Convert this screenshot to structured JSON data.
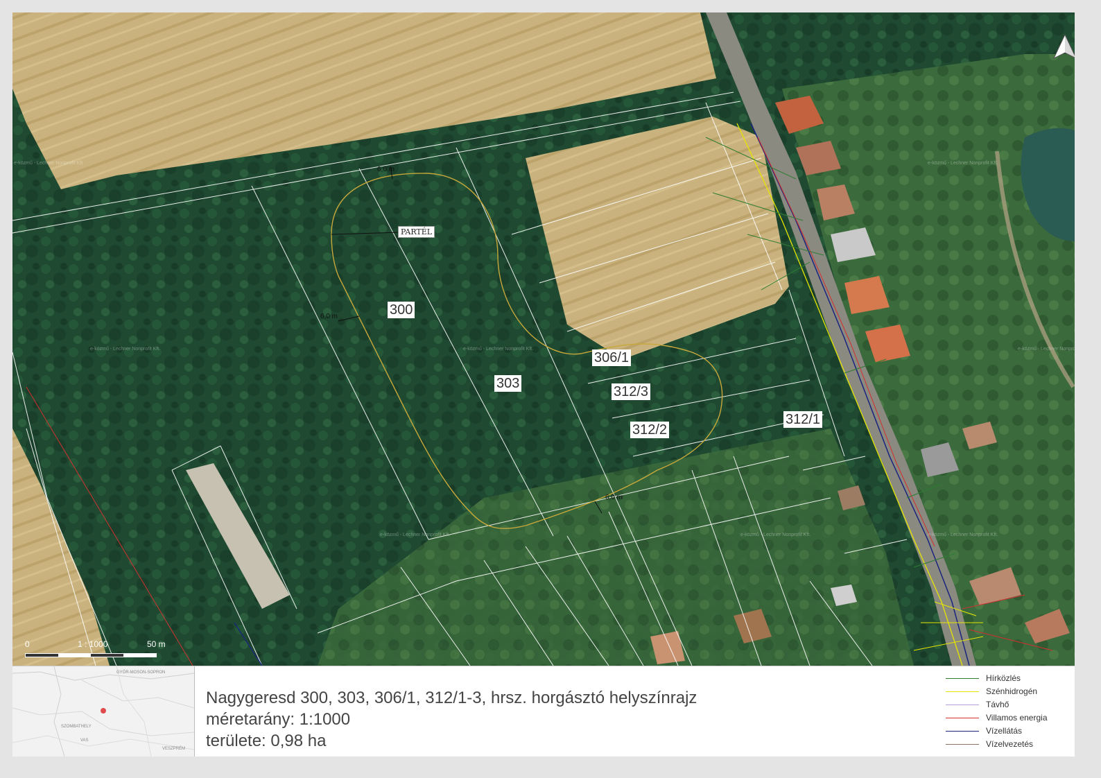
{
  "map": {
    "parcels": [
      {
        "id": "p300",
        "label": "300"
      },
      {
        "id": "p303",
        "label": "303"
      },
      {
        "id": "p306",
        "label": "306/1"
      },
      {
        "id": "p3123",
        "label": "312/3"
      },
      {
        "id": "p3122",
        "label": "312/2"
      },
      {
        "id": "p3121",
        "label": "312/1"
      }
    ],
    "dimensions": [
      "6,0 m",
      "6,0 m",
      "6,0 m"
    ],
    "partel_label": "PARTÉL",
    "watermark": "e-közmű - Lechner Nonprofit Kft.",
    "scale": {
      "start": "0",
      "ratio": "1 : 1000",
      "end": "50 m"
    },
    "north_icon": "north-arrow-icon",
    "colors": {
      "forest": "#1e4a30",
      "field": "#c8b07a",
      "lake": "#2b5c54",
      "road": "#8a8a80",
      "pond_outline": "#c8a83a"
    }
  },
  "footer": {
    "inset_labels": {
      "county1": "GYŐR-MOSON-SOPRON",
      "county2": "SZOMBATHELY",
      "county3": "VAS",
      "county4": "VESZPRÉM"
    },
    "title": "Nagygeresd 300, 303, 306/1, 312/1-3, hrsz. horgásztó helyszínrajz",
    "scale_line": "méretarány: 1:1000",
    "area_line": "területe: 0,98 ha",
    "legend": [
      {
        "label": "Hírközlés",
        "color": "#2e7d32"
      },
      {
        "label": "Szénhidrogén",
        "color": "#e6e600"
      },
      {
        "label": "Távhő",
        "color": "#b39ddb"
      },
      {
        "label": "Villamos energia",
        "color": "#d32f2f"
      },
      {
        "label": "Vízellátás",
        "color": "#1a237e"
      },
      {
        "label": "Vízelvezetés",
        "color": "#8d6e63"
      }
    ]
  }
}
